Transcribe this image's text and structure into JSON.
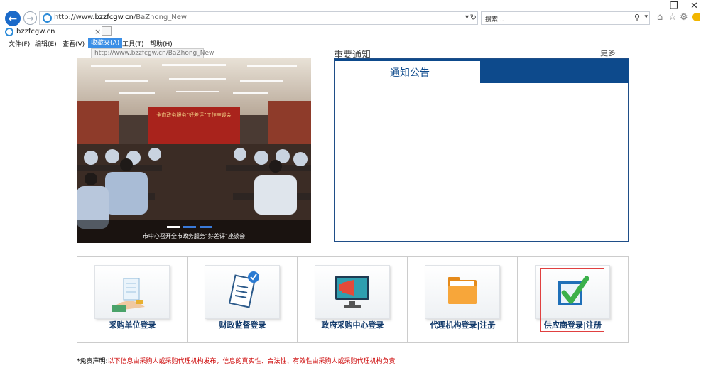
{
  "browser": {
    "url_prefix": "http://www.",
    "url_host": "bzzfcgw.cn",
    "url_path": "/BaZhong_New",
    "search_placeholder": "搜索...",
    "tab_title": "bzzfcgw.cn",
    "tab_close": "×",
    "menu": [
      "文件(F)",
      "编辑(E)",
      "查看(V)",
      "收藏夹(A)",
      "工具(T)",
      "帮助(H)"
    ],
    "dropdown_item": "http://www.bzzfcgw.cn/BaZhong_New"
  },
  "page": {
    "section_title_cut": "重要通知",
    "more_cut": "更多",
    "notice_tab": "通知公告",
    "slider_caption": "市中心召开全市政务服务“好差评”座谈会",
    "banner_text": "全市政务服务“好差评”工作座谈会",
    "tiles": [
      {
        "label": "采购单位登录",
        "icon": "document-hand-icon"
      },
      {
        "label": "财政监督登录",
        "icon": "clipboard-check-icon"
      },
      {
        "label": "政府采购中心登录",
        "icon": "monitor-megaphone-icon"
      },
      {
        "label": "代理机构登录|注册",
        "icon": "folder-icon"
      },
      {
        "label": "供应商登录|注册",
        "icon": "checkbox-icon"
      }
    ],
    "disclaimer_prefix": "*免责声明:",
    "disclaimer_text": "以下信息由采购人或采购代理机构发布，信息的真实性、合法性、有效性由采购人或采购代理机构负责"
  },
  "colors": {
    "accent": "#0d4a8c",
    "highlight": "#e04040"
  }
}
